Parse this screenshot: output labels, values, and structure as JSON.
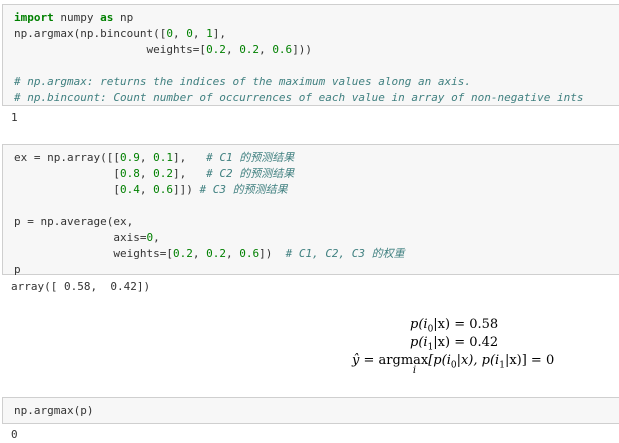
{
  "cells": [
    {
      "input_lines": [
        [
          {
            "t": "import",
            "c": "kw"
          },
          {
            "t": " numpy ",
            "c": ""
          },
          {
            "t": "as",
            "c": "kw"
          },
          {
            "t": " np",
            "c": ""
          }
        ],
        [
          {
            "t": "np.argmax(np.bincount([",
            "c": ""
          },
          {
            "t": "0",
            "c": "num"
          },
          {
            "t": ", ",
            "c": ""
          },
          {
            "t": "0",
            "c": "num"
          },
          {
            "t": ", ",
            "c": ""
          },
          {
            "t": "1",
            "c": "num"
          },
          {
            "t": "],",
            "c": ""
          }
        ],
        [
          {
            "t": "                    weights=[",
            "c": ""
          },
          {
            "t": "0.2",
            "c": "num"
          },
          {
            "t": ", ",
            "c": ""
          },
          {
            "t": "0.2",
            "c": "num"
          },
          {
            "t": ", ",
            "c": ""
          },
          {
            "t": "0.6",
            "c": "num"
          },
          {
            "t": "]))",
            "c": ""
          }
        ],
        [
          {
            "t": "",
            "c": ""
          }
        ],
        [
          {
            "t": "# np.argmax: returns the indices of the maximum values along an axis.",
            "c": "cm"
          }
        ],
        [
          {
            "t": "# np.bincount: Count number of occurrences of each value in array of non-negative ints",
            "c": "cm"
          }
        ]
      ],
      "output": "1"
    },
    {
      "input_lines": [
        [
          {
            "t": "ex = np.array([[",
            "c": ""
          },
          {
            "t": "0.9",
            "c": "num"
          },
          {
            "t": ", ",
            "c": ""
          },
          {
            "t": "0.1",
            "c": "num"
          },
          {
            "t": "],   ",
            "c": ""
          },
          {
            "t": "# C1 的预测结果",
            "c": "cm"
          }
        ],
        [
          {
            "t": "               [",
            "c": ""
          },
          {
            "t": "0.8",
            "c": "num"
          },
          {
            "t": ", ",
            "c": ""
          },
          {
            "t": "0.2",
            "c": "num"
          },
          {
            "t": "],   ",
            "c": ""
          },
          {
            "t": "# C2 的预测结果",
            "c": "cm"
          }
        ],
        [
          {
            "t": "               [",
            "c": ""
          },
          {
            "t": "0.4",
            "c": "num"
          },
          {
            "t": ", ",
            "c": ""
          },
          {
            "t": "0.6",
            "c": "num"
          },
          {
            "t": "]]) ",
            "c": ""
          },
          {
            "t": "# C3 的预测结果",
            "c": "cm"
          }
        ],
        [
          {
            "t": "",
            "c": ""
          }
        ],
        [
          {
            "t": "p = np.average(ex,",
            "c": ""
          }
        ],
        [
          {
            "t": "               axis=",
            "c": ""
          },
          {
            "t": "0",
            "c": "num"
          },
          {
            "t": ",",
            "c": ""
          }
        ],
        [
          {
            "t": "               weights=[",
            "c": ""
          },
          {
            "t": "0.2",
            "c": "num"
          },
          {
            "t": ", ",
            "c": ""
          },
          {
            "t": "0.2",
            "c": "num"
          },
          {
            "t": ", ",
            "c": ""
          },
          {
            "t": "0.6",
            "c": "num"
          },
          {
            "t": "])  ",
            "c": ""
          },
          {
            "t": "# C1, C2, C3 的权重",
            "c": "cm"
          }
        ],
        [
          {
            "t": "p",
            "c": ""
          }
        ]
      ],
      "output": "array([ 0.58,  0.42])"
    },
    {
      "input_lines": [
        [
          {
            "t": "np.argmax(p)",
            "c": ""
          }
        ]
      ],
      "output": "0"
    }
  ],
  "math": {
    "line1": {
      "lhs": "p(i",
      "sub": "0",
      "mid": "|x) = ",
      "val": "0.58"
    },
    "line2": {
      "lhs": "p(i",
      "sub": "1",
      "mid": "|x) = ",
      "val": "0.42"
    },
    "line3": {
      "yhat": "ŷ",
      "eq": " = arg",
      "max": "max",
      "under": "i",
      "a": "[p(i",
      "s0": "0",
      "b": "|x), p(i",
      "s1": "1",
      "c": "|x)] = ",
      "val": "0"
    }
  }
}
